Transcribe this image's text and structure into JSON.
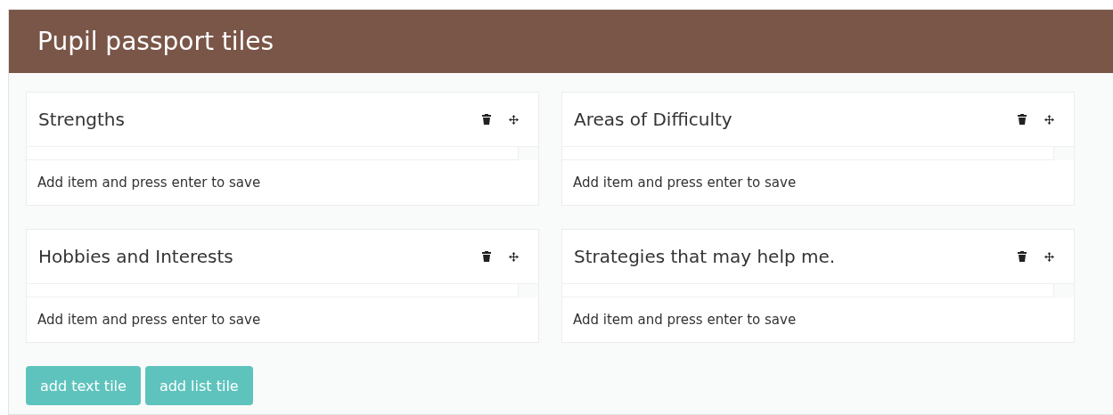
{
  "panel": {
    "title": "Pupil passport tiles"
  },
  "tiles": [
    {
      "title": "Strengths",
      "placeholder": "Add item and press enter to save"
    },
    {
      "title": "Areas of Difficulty",
      "placeholder": "Add item and press enter to save"
    },
    {
      "title": "Hobbies and Interests",
      "placeholder": "Add item and press enter to save"
    },
    {
      "title": "Strategies that may help me.",
      "placeholder": "Add item and press enter to save"
    }
  ],
  "buttons": [
    "add text tile",
    "add list tile"
  ]
}
